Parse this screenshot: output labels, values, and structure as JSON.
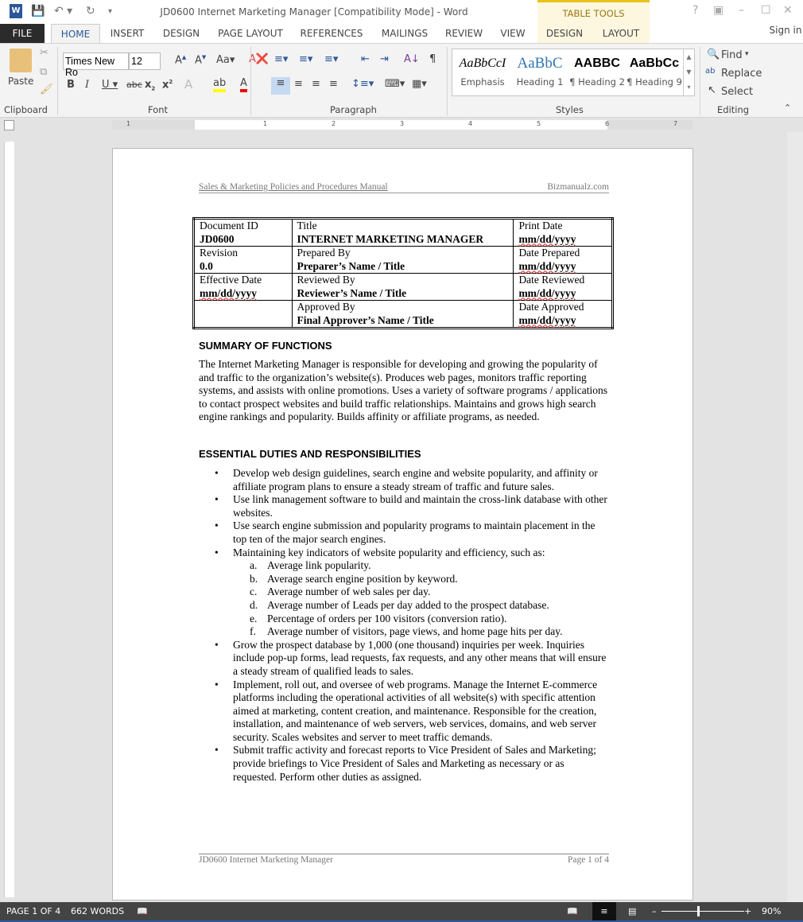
{
  "window": {
    "title": "JD0600 Internet Marketing Manager [Compatibility Mode] - Word",
    "contextual_group": "TABLE TOOLS",
    "sign_in": "Sign in"
  },
  "tabs": [
    "FILE",
    "HOME",
    "INSERT",
    "DESIGN",
    "PAGE LAYOUT",
    "REFERENCES",
    "MAILINGS",
    "REVIEW",
    "VIEW",
    "DESIGN",
    "LAYOUT"
  ],
  "ribbon": {
    "clipboard": {
      "label": "Clipboard",
      "paste": "Paste"
    },
    "font": {
      "label": "Font",
      "font_name": "Times New Ro",
      "font_size": "12"
    },
    "paragraph": {
      "label": "Paragraph"
    },
    "styles": {
      "label": "Styles",
      "items": [
        {
          "preview": "AaBbCcI",
          "name": "Emphasis"
        },
        {
          "preview": "AaBbC",
          "name": "Heading 1"
        },
        {
          "preview": "AABBC",
          "name": "¶ Heading 2"
        },
        {
          "preview": "AaBbCc",
          "name": "¶ Heading 9"
        }
      ]
    },
    "editing": {
      "label": "Editing",
      "find": "Find",
      "replace": "Replace",
      "select": "Select"
    }
  },
  "ruler": {
    "marks": [
      "1",
      "1",
      "2",
      "3",
      "4",
      "5",
      "6",
      "7"
    ]
  },
  "document": {
    "header_left": "Sales & Marketing Policies and Procedures Manual",
    "header_right": "Bizmanualz.com",
    "table": [
      [
        {
          "label": "Document ID",
          "value": "JD0600"
        },
        {
          "label": "Title",
          "value": "INTERNET MARKETING MANAGER"
        },
        {
          "label": "Print Date",
          "value": "mm/dd/yyyy"
        }
      ],
      [
        {
          "label": "Revision",
          "value": "0.0"
        },
        {
          "label": "Prepared By",
          "value": "Preparer’s Name / Title"
        },
        {
          "label": "Date Prepared",
          "value": "mm/dd/yyyy"
        }
      ],
      [
        {
          "label": "Effective Date",
          "value": "mm/dd/yyyy"
        },
        {
          "label": "Reviewed By",
          "value": "Reviewer’s Name / Title"
        },
        {
          "label": "Date Reviewed",
          "value": "mm/dd/yyyy"
        }
      ],
      [
        {
          "label": "",
          "value": ""
        },
        {
          "label": "Approved By",
          "value": "Final Approver’s Name / Title"
        },
        {
          "label": "Date Approved",
          "value": "mm/dd/yyyy"
        }
      ]
    ],
    "summary_heading": "SUMMARY OF FUNCTIONS",
    "summary": "The Internet Marketing Manager is responsible for developing and growing the popularity of and traffic to the organization’s website(s).  Produces web pages, monitors traffic reporting systems, and assists with online promotions.  Uses a variety of software programs / applications to contact prospect websites and build traffic relationships.  Maintains and grows high search engine rankings and popularity.  Builds affinity or affiliate programs, as needed.",
    "duties_heading": "ESSENTIAL DUTIES AND RESPONSIBILITIES",
    "duties": [
      "Develop web design guidelines, search engine and website popularity, and affinity or affiliate program plans to ensure a steady stream of traffic and future sales.",
      "Use link management software to build and maintain the cross-link database with other websites.",
      "Use search engine submission and popularity programs to maintain placement in the top ten of the major search engines.",
      "Maintaining key indicators of website popularity and efficiency, such as:",
      "Grow the prospect database by 1,000 (one thousand) inquiries per week.  Inquiries include pop-up forms, lead requests, fax requests, and any other means that will ensure a steady stream of qualified leads to sales.",
      "Implement, roll out, and oversee of web programs.  Manage the Internet E-commerce platforms including the operational activities of all website(s) with specific attention aimed at marketing, content creation, and maintenance.  Responsible for the creation, installation, and maintenance of web servers, web services, domains, and web server security.  Scales websites and server to meet traffic demands.",
      "Submit traffic activity and forecast reports to Vice President of Sales and Marketing; provide briefings to Vice President of Sales and Marketing as necessary or as requested.  Perform other duties as assigned."
    ],
    "indicators": [
      {
        "letter": "a.",
        "text": "Average link popularity."
      },
      {
        "letter": "b.",
        "text": "Average search engine position by keyword."
      },
      {
        "letter": "c.",
        "text": "Average number of web sales per day."
      },
      {
        "letter": "d.",
        "text": "Average number of Leads per day added to the prospect database."
      },
      {
        "letter": "e.",
        "text": "Percentage of orders per 100 visitors (conversion ratio)."
      },
      {
        "letter": "f.",
        "text": "Average number of visitors, page views, and home page hits per day."
      }
    ],
    "footer_left": "JD0600 Internet Marketing Manager",
    "footer_right": "Page 1 of 4"
  },
  "status": {
    "page": "PAGE 1 OF 4",
    "words": "662 WORDS",
    "zoom": "90%",
    "zoom_level_percent": 90
  }
}
